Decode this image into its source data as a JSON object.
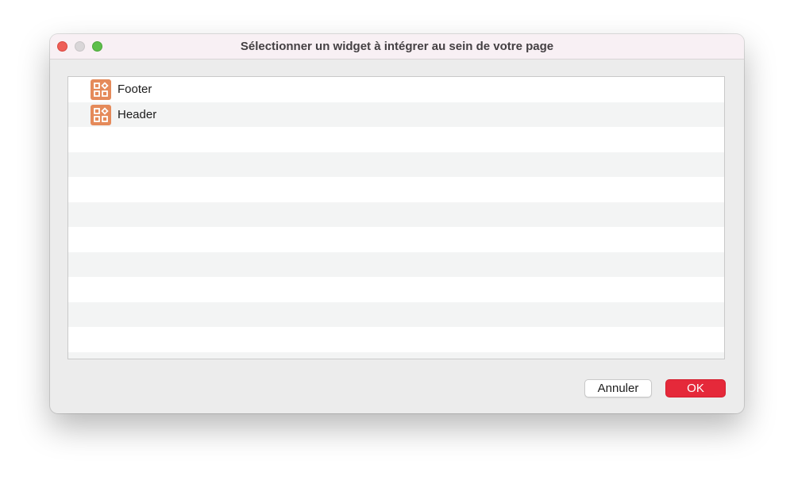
{
  "dialog": {
    "title": "Sélectionner un widget à intégrer au sein de votre page"
  },
  "list": {
    "items": [
      {
        "label": "Footer",
        "icon": "widget-icon"
      },
      {
        "label": "Header",
        "icon": "widget-icon"
      }
    ],
    "icon_color": "#e58a5a"
  },
  "buttons": {
    "cancel_label": "Annuler",
    "ok_label": "OK",
    "ok_color": "#e5293a"
  }
}
